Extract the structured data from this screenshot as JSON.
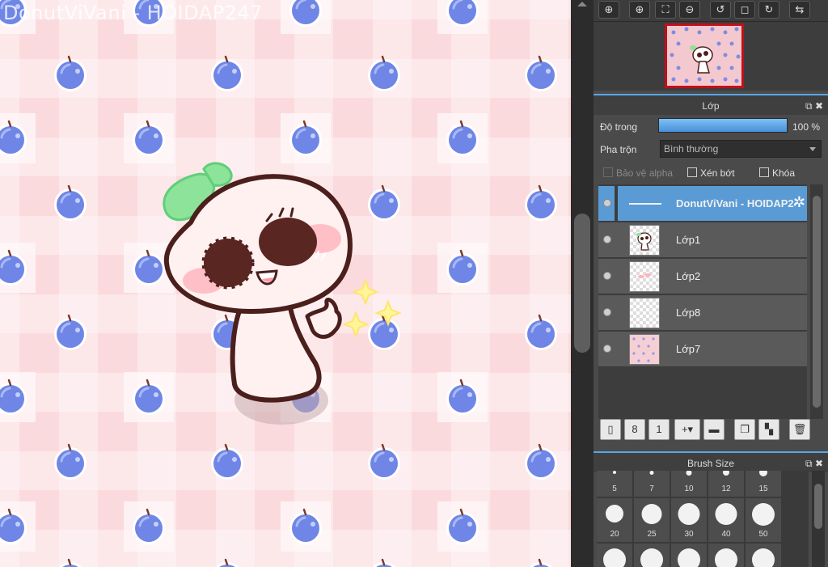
{
  "canvas": {
    "watermark": "DonutViVani - HOIDAP247"
  },
  "navigator": {
    "toolbar_icons": [
      "zoom-actual-icon",
      "zoom-in-icon",
      "fit-window-icon",
      "zoom-out-icon",
      "rotate-left-icon",
      "fullscreen-icon",
      "rotate-right-icon",
      "flip-icon"
    ]
  },
  "layer_panel": {
    "title": "Lớp",
    "opacity_label": "Độ trong",
    "opacity_value": "100 %",
    "opacity_fraction": 1.0,
    "blend_label": "Pha trộn",
    "blend_value": "Bình thường",
    "protect_alpha_label": "Bảo vệ alpha",
    "clipping_label": "Xén bớt",
    "lock_label": "Khóa",
    "layers": [
      {
        "name": "DonutViVani - HOIDAP247",
        "selected": true
      },
      {
        "name": "Lớp1",
        "selected": false
      },
      {
        "name": "Lớp2",
        "selected": false
      },
      {
        "name": "Lớp8",
        "selected": false
      },
      {
        "name": "Lớp7",
        "selected": false
      }
    ],
    "buttons": [
      "new-layer-icon",
      "new-layer-8bit-icon",
      "new-layer-1bit-icon",
      "add-layer-dropdown-icon",
      "folder-icon",
      "duplicate-layer-icon",
      "merge-down-icon",
      "delete-layer-icon"
    ]
  },
  "brush_panel": {
    "title": "Brush Size",
    "sizes_row1": [
      "5",
      "7",
      "10",
      "12",
      "15"
    ],
    "sizes_row2": [
      "20",
      "25",
      "30",
      "40",
      "50"
    ]
  },
  "colors": {
    "accent": "#58a6e8",
    "selected_layer": "#5a9bd6",
    "nav_frame": "#c0101a"
  }
}
